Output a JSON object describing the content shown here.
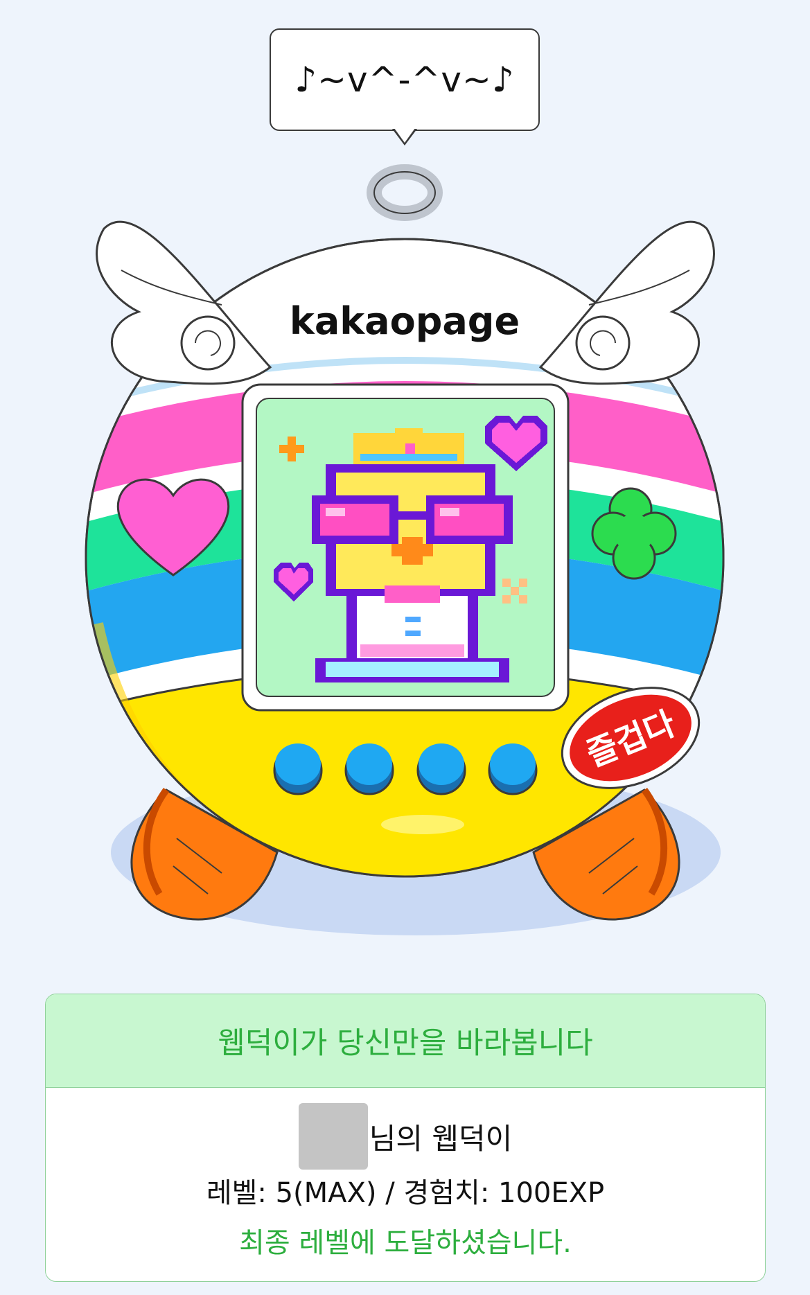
{
  "speech_bubble": {
    "text": "♪~v^-^v~♪"
  },
  "device": {
    "brand": "kakaopage",
    "sticker_text": "즐겁다",
    "button_count": 4,
    "colors": {
      "rainbow_pink": "#ff5fc8",
      "rainbow_green": "#1ee39a",
      "rainbow_blue": "#23a6f0",
      "body_yellow": "#ffe600",
      "screen_green": "#b3f7c4",
      "button_blue": "#1fa8f2",
      "feet_orange": "#ff7a0f",
      "sticker_red": "#e8201b"
    }
  },
  "status_card": {
    "header": "웹덕이가 당신만을 바라봅니다",
    "owner_suffix": "님의 웹덕이",
    "level_line": "레벨: 5(MAX) / 경험치: 100EXP",
    "final_message": "최종 레벨에 도달하셨습니다."
  }
}
